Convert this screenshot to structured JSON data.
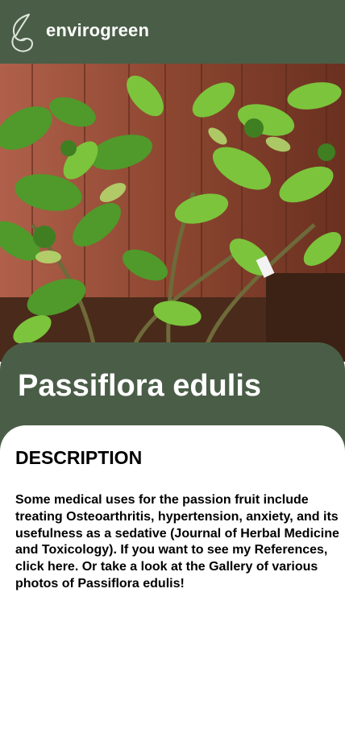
{
  "header": {
    "logo_icon": "leaf-logo-icon",
    "brand_name": "envirogreen",
    "background": "#4a5e47"
  },
  "hero": {
    "image": "photo of a potted green leafy plant in front of a wooden fence"
  },
  "plant": {
    "title": "Passiflora edulis"
  },
  "description": {
    "heading": "DESCRIPTION",
    "text_before_link1": "Some medical uses for the passion fruit include treating Osteoarthritis, hypertension, anxiety, and its usefulness as a sedative (Journal of Herbal Medicine and Toxicology). If you want to see my References, ",
    "link_references": "click here",
    "text_between": ". Or take a look at the ",
    "link_gallery": "Gallery",
    "text_after": " of various photos of Passiflora edulis!"
  }
}
